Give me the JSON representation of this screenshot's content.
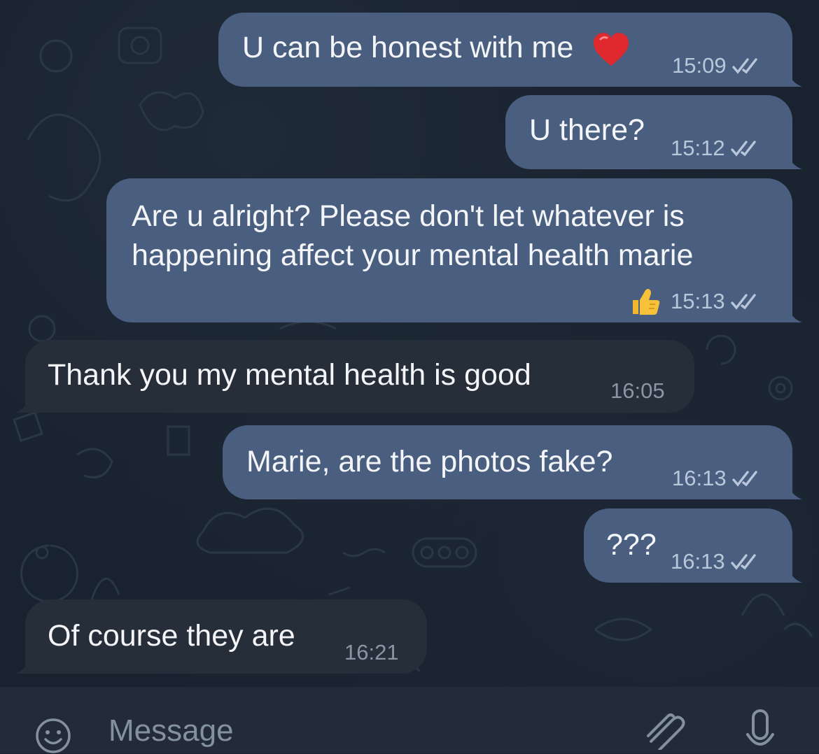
{
  "messages": [
    {
      "direction": "out",
      "text": "U can be honest with me",
      "emoji": "heart",
      "time": "15:09",
      "status": "read"
    },
    {
      "direction": "out",
      "text": "U there?",
      "time": "15:12",
      "status": "read"
    },
    {
      "direction": "out",
      "text_line1": "Are u alright? Please don't let whatever is",
      "text_line2": "happening affect your mental health marie",
      "reaction": "thumbs-up",
      "time": "15:13",
      "status": "read"
    },
    {
      "direction": "in",
      "text": "Thank you my mental health is good",
      "time": "16:05"
    },
    {
      "direction": "out",
      "text": "Marie, are the photos fake?",
      "time": "16:13",
      "status": "read"
    },
    {
      "direction": "out",
      "text": "???",
      "time": "16:13",
      "status": "read"
    },
    {
      "direction": "in",
      "text": "Of course they are",
      "time": "16:21"
    }
  ],
  "composer": {
    "placeholder": "Message"
  },
  "colors": {
    "outgoing_bubble": "#4a5f80",
    "incoming_bubble": "#262e3a",
    "background": "#19222f"
  }
}
